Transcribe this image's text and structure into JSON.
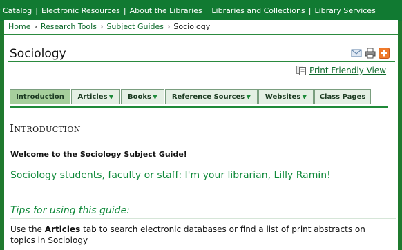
{
  "top_nav": {
    "items": [
      "y Catalog",
      "Electronic Resources",
      "About the Libraries",
      "Libraries and Collections",
      "Library Services"
    ],
    "separator": "|"
  },
  "breadcrumb": {
    "items": [
      "Home",
      "Research Tools",
      "Subject Guides",
      "Sociology"
    ],
    "separator": "›"
  },
  "page": {
    "title": "Sociology",
    "print_friendly": "Print Friendly View"
  },
  "icons": [
    "email-icon",
    "print-icon",
    "add-icon",
    "print-friendly-icon"
  ],
  "tabs": [
    {
      "label": "Introduction",
      "has_dropdown": false,
      "active": true
    },
    {
      "label": "Articles",
      "has_dropdown": true,
      "active": false
    },
    {
      "label": "Books",
      "has_dropdown": true,
      "active": false
    },
    {
      "label": "Reference Sources",
      "has_dropdown": true,
      "active": false
    },
    {
      "label": "Websites",
      "has_dropdown": true,
      "active": false
    },
    {
      "label": "Class Pages",
      "has_dropdown": false,
      "active": false
    }
  ],
  "content": {
    "section_heading": "Introduction",
    "welcome": "Welcome to the Sociology Subject Guide!",
    "librarian": "Sociology students, faculty or staff: I'm your librarian, Lilly Ramin!",
    "tips_heading": "Tips for using this guide:",
    "body_prefix": "Use the ",
    "body_bold": "Articles",
    "body_suffix": " tab to search electronic databases or find a list of print abstracts on topics in Sociology"
  },
  "colors": {
    "frame_green": "#1f7a2e",
    "nav_green": "#117a32",
    "link_green": "#0f6a2c",
    "accent_green": "#10893a",
    "active_tab": "#a6cf9c",
    "tab_bg": "#e4efe4",
    "add_orange": "#f07a2a"
  }
}
